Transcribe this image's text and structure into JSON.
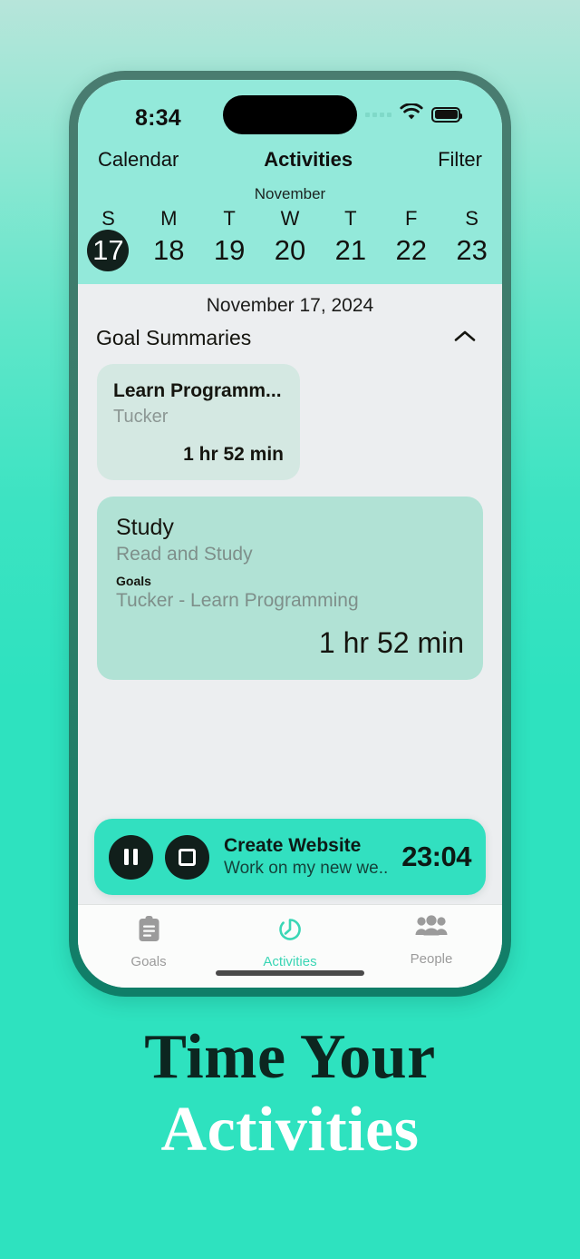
{
  "status_bar": {
    "time": "8:34",
    "cellular_icon": "cellular-dots-icon",
    "wifi_icon": "wifi-icon",
    "battery_icon": "battery-full-icon"
  },
  "navbar": {
    "left_label": "Calendar",
    "title": "Activities",
    "right_label": "Filter"
  },
  "week_strip": {
    "month": "November",
    "days": [
      {
        "dow": "S",
        "num": "17",
        "selected": true
      },
      {
        "dow": "M",
        "num": "18",
        "selected": false
      },
      {
        "dow": "T",
        "num": "19",
        "selected": false
      },
      {
        "dow": "W",
        "num": "20",
        "selected": false
      },
      {
        "dow": "T",
        "num": "21",
        "selected": false
      },
      {
        "dow": "F",
        "num": "22",
        "selected": false
      },
      {
        "dow": "S",
        "num": "23",
        "selected": false
      }
    ]
  },
  "content": {
    "date_title": "November 17, 2024",
    "section_title": "Goal Summaries",
    "collapse_icon": "chevron-up-icon",
    "goal_summary_card": {
      "title": "Learn Programm...",
      "person": "Tucker",
      "duration": "1 hr 52 min"
    },
    "activity_card": {
      "title": "Study",
      "description": "Read and Study",
      "goals_label": "Goals",
      "goals_value": "Tucker - Learn Programming",
      "duration": "1 hr 52 min"
    }
  },
  "timer_bar": {
    "pause_icon": "pause-icon",
    "stop_icon": "stop-icon",
    "title": "Create Website",
    "subtitle": "Work on my new we...",
    "elapsed": "23:04",
    "accent_color": "#32e0c0"
  },
  "tab_bar": {
    "tabs": [
      {
        "label": "Goals",
        "icon": "clipboard-icon",
        "active": false
      },
      {
        "label": "Activities",
        "icon": "stopwatch-icon",
        "active": true
      },
      {
        "label": "People",
        "icon": "people-group-icon",
        "active": false
      }
    ],
    "active_color": "#3ad6b5",
    "inactive_color": "#9b9b9b"
  },
  "headline": {
    "line1": "Time Your",
    "line2": "Activities",
    "line1_color": "#0c2620",
    "line2_color": "#ffffff"
  }
}
